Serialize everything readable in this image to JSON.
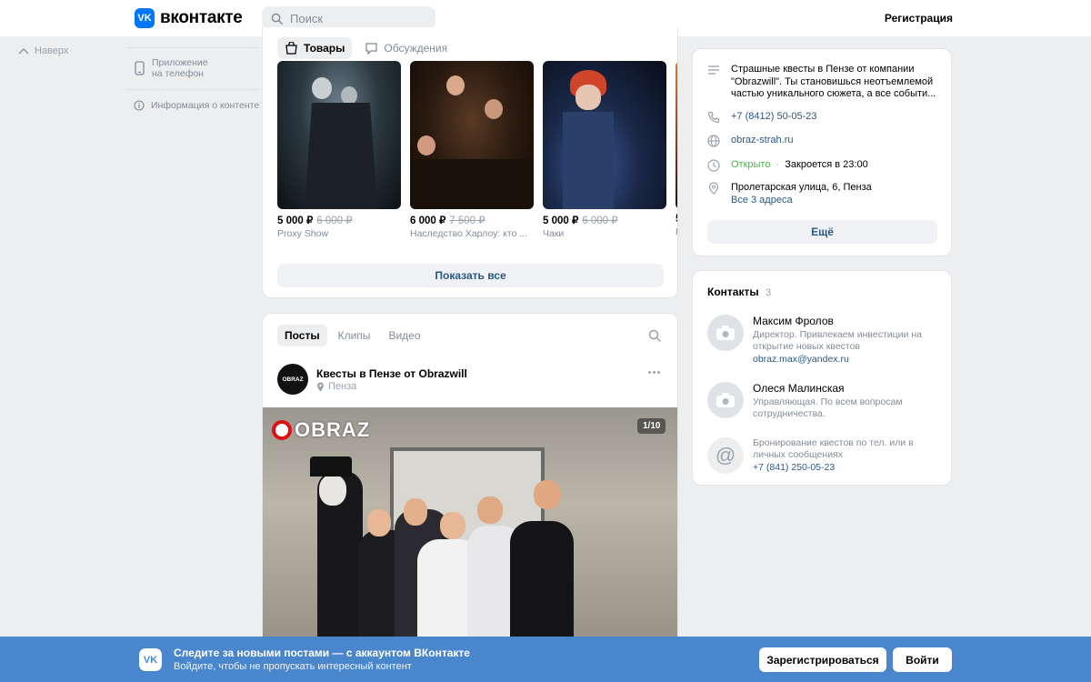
{
  "header": {
    "logo_mark": "VK",
    "logo_text": "вконтакте",
    "search_placeholder": "Поиск",
    "register_link": "Регистрация"
  },
  "left": {
    "back_to_top": "Наверх",
    "app_line1": "Приложение",
    "app_line2": "на телефон",
    "content_info": "Информация о контенте"
  },
  "market": {
    "tabs": [
      {
        "label": "Товары",
        "active": true
      },
      {
        "label": "Обсуждения",
        "active": false
      }
    ],
    "products": [
      {
        "price": "5 000 ₽",
        "old_price": "6 000 ₽",
        "name": "Proxy Show"
      },
      {
        "price": "6 000 ₽",
        "old_price": "7 500 ₽",
        "name": "Наследство Харлоу: кто ..."
      },
      {
        "price": "5 000 ₽",
        "old_price": "6 000 ₽",
        "name": "Чаки"
      },
      {
        "price": "5",
        "old_price": "",
        "name": "К"
      }
    ],
    "show_all": "Показать все"
  },
  "feed": {
    "tabs": [
      {
        "label": "Посты",
        "active": true
      },
      {
        "label": "Клипы",
        "active": false
      },
      {
        "label": "Видео",
        "active": false
      }
    ],
    "post": {
      "author": "Квесты в Пензе от Obrazwill",
      "avatar_text": "OBRAZ",
      "location": "Пенза",
      "photo_counter": "1/10",
      "photo_logo": "OBRAZ"
    }
  },
  "info": {
    "description": "Страшные квесты в Пензе от компании \"Obrazwill\". Ты становишься неотъемлемой частью уникального сюжета, а все событи...",
    "phone": "+7 (8412) 50-05-23",
    "site": "obraz-strah.ru",
    "status_open": "Открыто",
    "status_sep": "·",
    "status_close": "Закроется в 23:00",
    "address": "Пролетарская улица, 6, Пенза",
    "all_addresses": "Все 3 адреса",
    "more": "Ещё"
  },
  "contacts": {
    "title": "Контакты",
    "count": "3",
    "items": [
      {
        "name": "Максим Фролов",
        "desc": "Директор. Привлекаем инвестиции на открытие новых квестов",
        "link": "obraz.max@yandex.ru"
      },
      {
        "name": "Олеся Малинская",
        "desc": "Управляющая. По всем вопросам сотрудничества.",
        "link": ""
      },
      {
        "name": "",
        "desc": "Бронирование квестов по тел. или в личных сообщениях",
        "link": "+7 (841) 250-05-23"
      }
    ]
  },
  "banner": {
    "logo_mark": "VK",
    "title": "Следите за новыми постами — с аккаунтом ВКонтакте",
    "subtitle": "Войдите, чтобы не пропускать интересный контент",
    "register_button": "Зарегистрироваться",
    "login_button": "Войти"
  },
  "colors": {
    "brand": "#0077ff",
    "link": "#2a5885",
    "open_status": "#4bb34b",
    "banner": "#4a86cc"
  }
}
